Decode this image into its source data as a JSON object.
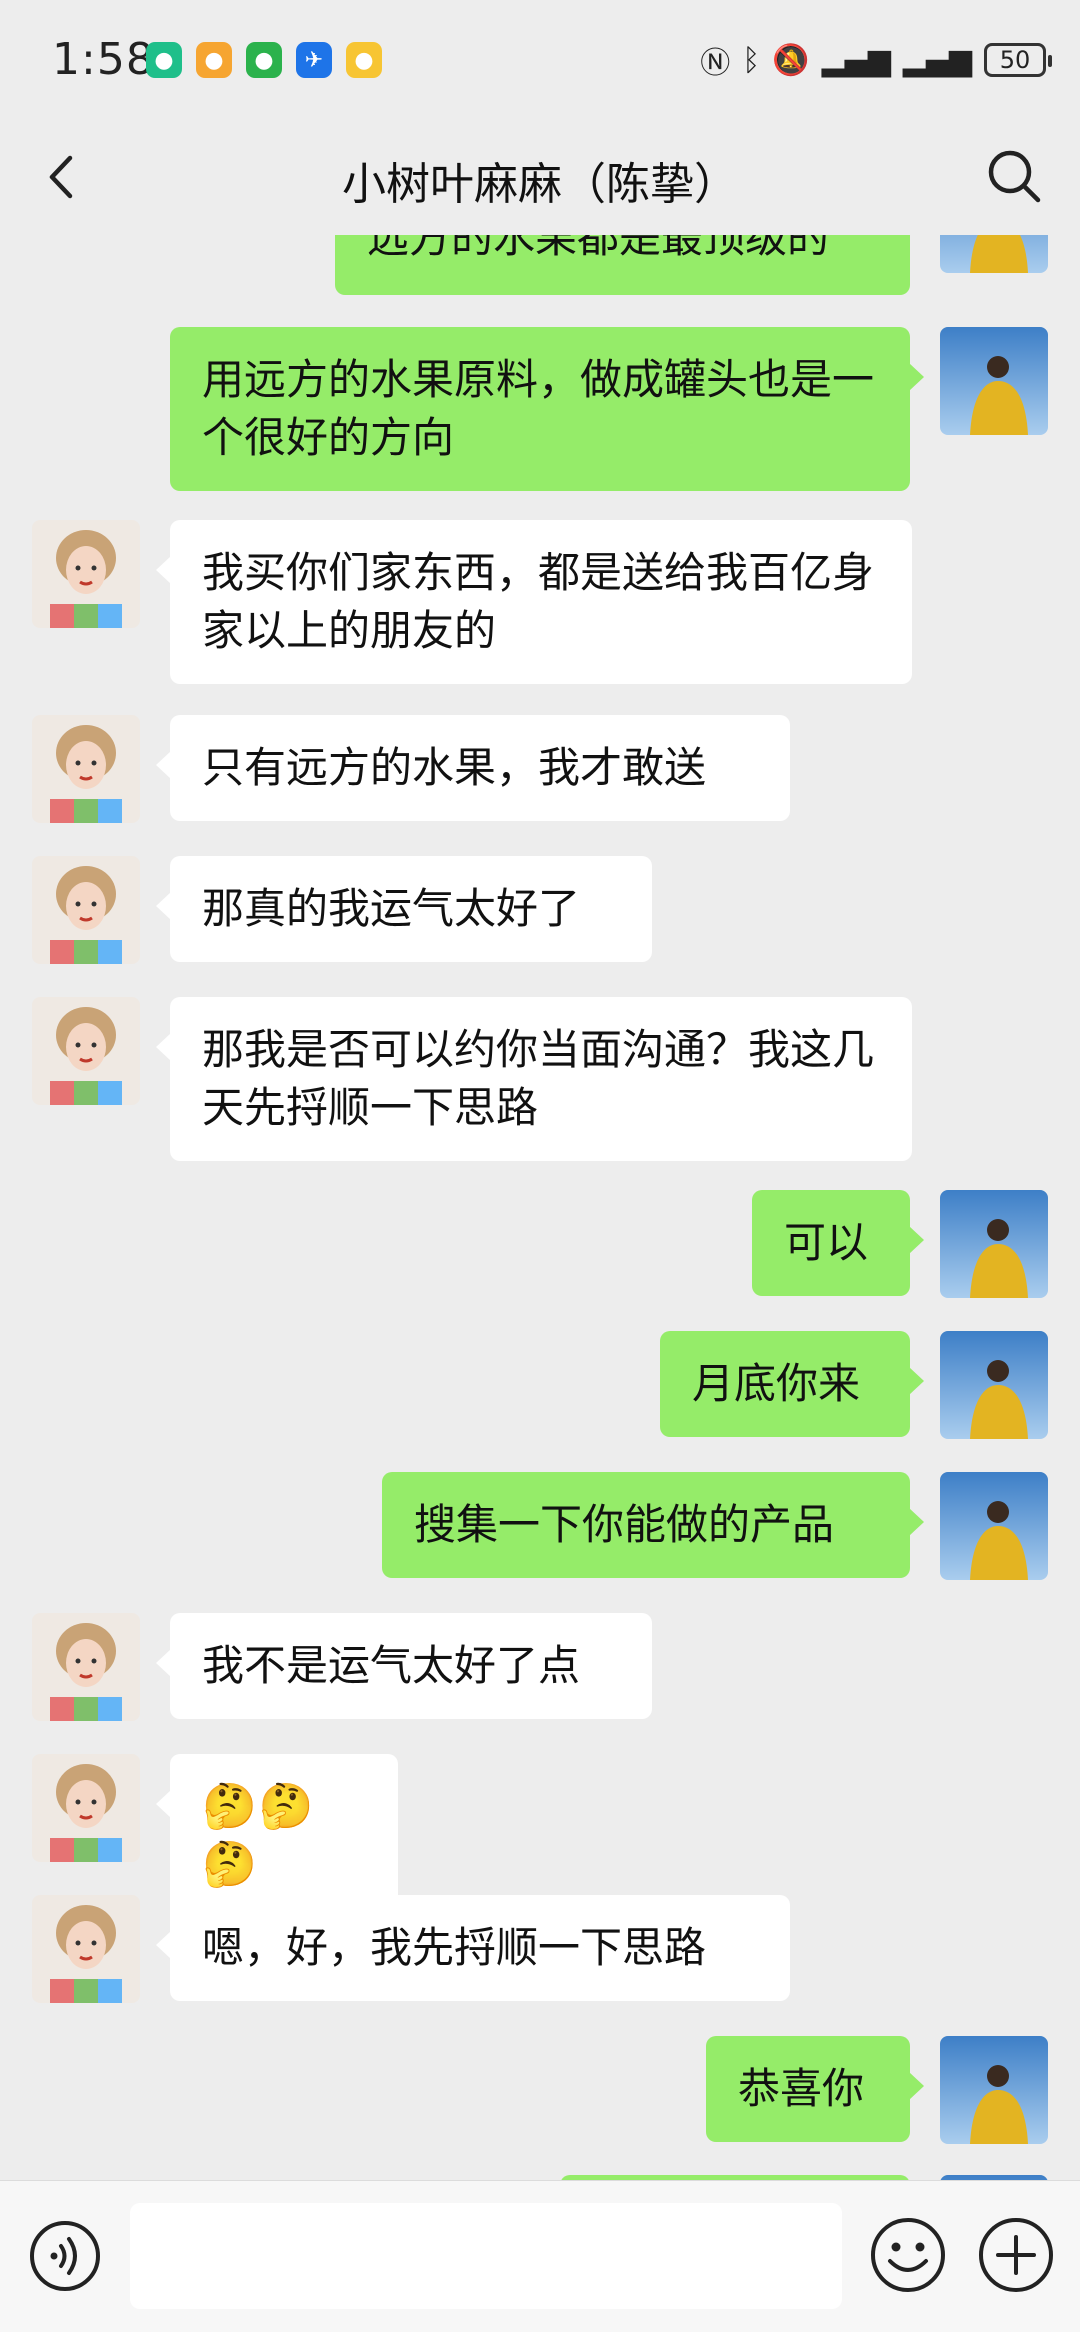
{
  "status_bar": {
    "time": "1:58",
    "battery": "50",
    "notification_apps": [
      "app-icon-green",
      "app-icon-orange",
      "app-icon-green-2",
      "app-icon-blue",
      "app-icon-yellow"
    ]
  },
  "header": {
    "title": "小树叶麻麻（陈挚）"
  },
  "messages": [
    {
      "side": "right",
      "sender": "me",
      "text": "远方的水果都是最顶级的"
    },
    {
      "side": "right",
      "sender": "me",
      "text": "用远方的水果原料，做成罐头也是一个很好的方向"
    },
    {
      "side": "left",
      "sender": "other",
      "text": "我买你们家东西，都是送给我百亿身家以上的朋友的"
    },
    {
      "side": "left",
      "sender": "other",
      "text": "只有远方的水果，我才敢送"
    },
    {
      "side": "left",
      "sender": "other",
      "text": "那真的我运气太好了"
    },
    {
      "side": "left",
      "sender": "other",
      "text": "那我是否可以约你当面沟通？我这几天先捋顺一下思路"
    },
    {
      "side": "right",
      "sender": "me",
      "text": "可以"
    },
    {
      "side": "right",
      "sender": "me",
      "text": "月底你来"
    },
    {
      "side": "right",
      "sender": "me",
      "text": "搜集一下你能做的产品"
    },
    {
      "side": "left",
      "sender": "other",
      "text": "我不是运气太好了点"
    },
    {
      "side": "left",
      "sender": "other",
      "text": "🤔🤔🤔"
    },
    {
      "side": "left",
      "sender": "other",
      "text": "嗯，好，我先捋顺一下思路"
    },
    {
      "side": "right",
      "sender": "me",
      "text": "恭喜你"
    },
    {
      "side": "right",
      "sender": "me",
      "text": ""
    }
  ],
  "input_bar": {
    "placeholder": "",
    "value": ""
  },
  "colors": {
    "background": "#ededed",
    "bubble_me": "#95ec69",
    "bubble_other": "#ffffff"
  }
}
